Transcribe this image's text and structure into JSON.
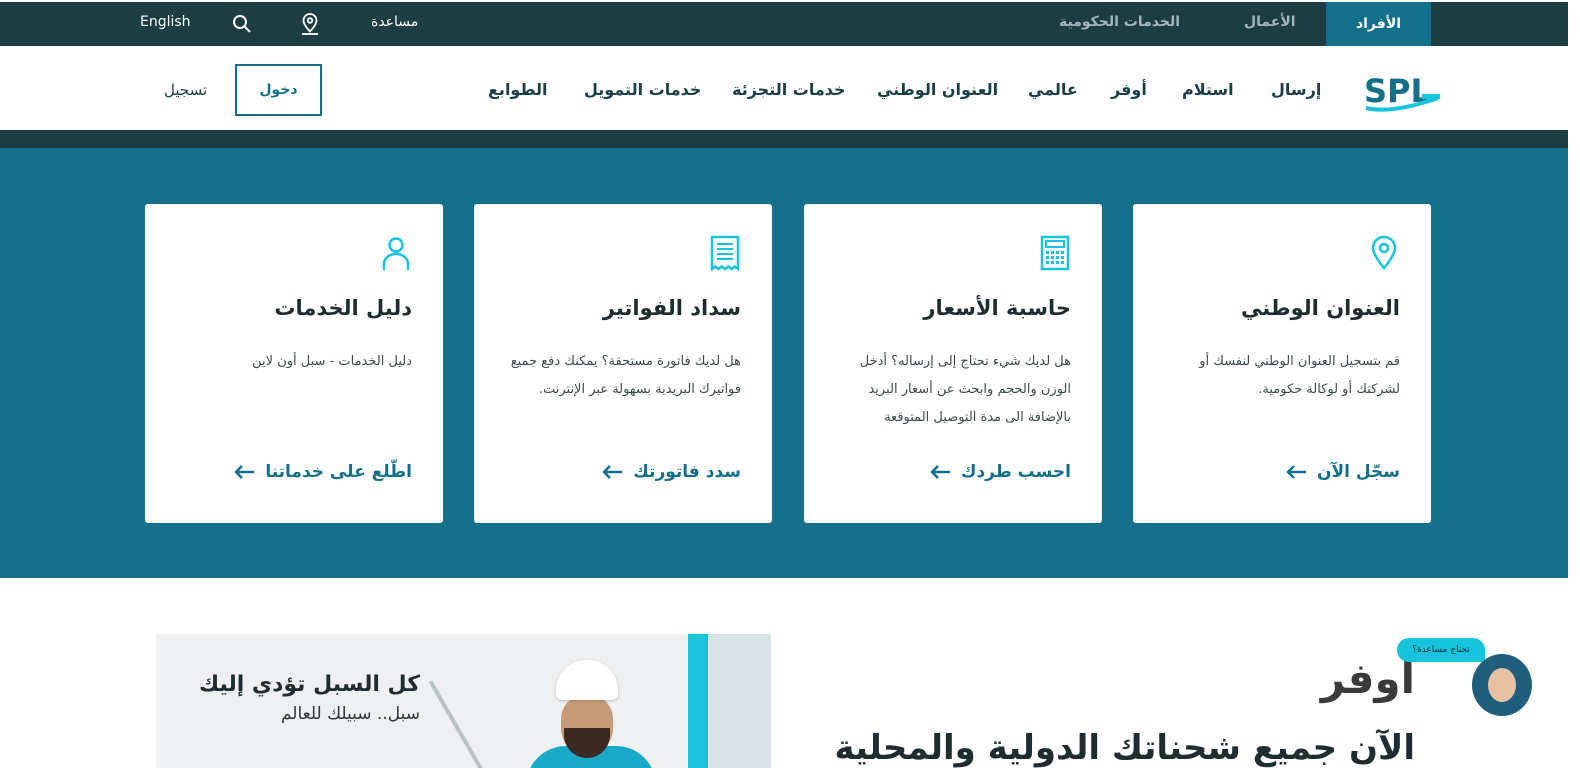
{
  "topbar": {
    "segments": {
      "individuals": "الأفراد",
      "business": "الأعمال",
      "government": "الخدمات الحكومية"
    },
    "help": "مساعدة",
    "language": "English",
    "icons": {
      "location": "location-pin-icon",
      "search": "search-icon"
    }
  },
  "nav": {
    "items": [
      "إرسال",
      "استلام",
      "أوفر",
      "عالمي",
      "العنوان الوطني",
      "خدمات التجزئة",
      "خدمات التمويل",
      "الطوابع"
    ],
    "login": "دخول",
    "register": "تسجيل"
  },
  "cards": [
    {
      "icon": "location-pin-icon",
      "title": "العنوان الوطني",
      "description": "قم بتسجيل العنوان الوطني لنفسك أو لشركتك أو لوكالة حكومية.",
      "link": "سجّل الآن"
    },
    {
      "icon": "calculator-icon",
      "title": "حاسبة الأسعار",
      "description": "هل لديك شيء تحتاج إلى إرساله؟ أدخل الوزن والحجم وابحث عن أسعار البريد بالإضافة الى مدة التوصيل المتوقعة",
      "link": "احسب طردك"
    },
    {
      "icon": "receipt-icon",
      "title": "سداد الفواتير",
      "description": "هل لديك فاتورة مستحقة؟ يمكنك دفع جميع فواتيرك البريدية بسهولة عبر الإنترنت.",
      "link": "سدد فاتورتك"
    },
    {
      "icon": "person-icon",
      "title": "دليل الخدمات",
      "description": "دليل الخدمات - سبل أون لاين",
      "link": "اطّلع على خدماتنا"
    }
  ],
  "banner": {
    "title": "كل السبل تؤدي إليك",
    "subtitle": "سبل.. سبيلك للعالم"
  },
  "aufar": {
    "title": "اوفر",
    "subtitle": "الآن جميع شحناتك الدولية والمحلية"
  },
  "help_widget": {
    "label": "تحتاج مساعدة؟"
  },
  "colors": {
    "primary": "#14708a",
    "dark": "#1c3d42",
    "accent": "#17c4dd"
  }
}
